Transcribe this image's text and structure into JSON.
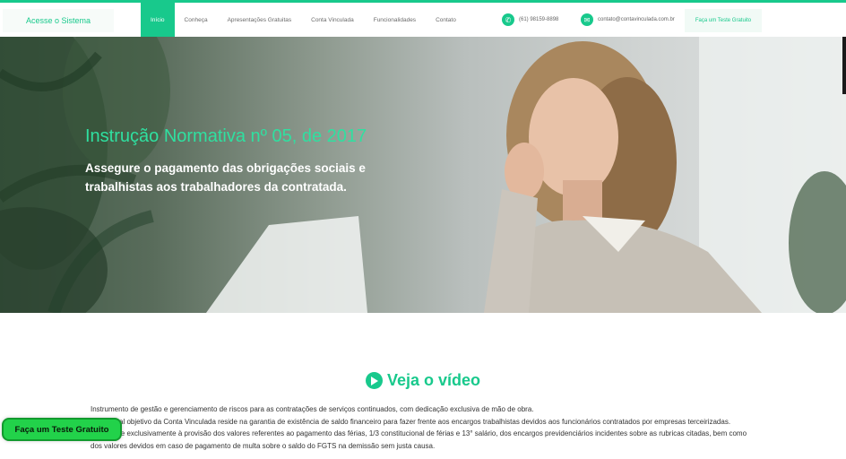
{
  "header": {
    "login": "Acesse o Sistema",
    "nav": [
      "Início",
      "Conheça",
      "Apresentações Gratuitas",
      "Conta Vinculada",
      "Funcionalidades",
      "Contato"
    ],
    "phone": "(61) 98159-8898",
    "email": "contato@contavinculada.com.br",
    "trial": "Faça um Teste Gratuito"
  },
  "hero": {
    "title": "Instrução Normativa nº 05, de 2017",
    "subtitle": "Assegure o pagamento das obrigações sociais e trabalhistas aos trabalhadores da contratada."
  },
  "video": {
    "heading": "Veja o vídeo"
  },
  "content": {
    "p1": "Instrumento de gestão e gerenciamento de riscos para as contratações de serviços continuados, com dedicação exclusiva de mão de obra.",
    "p2": "O principal objetivo da Conta Vinculada reside na garantia de existência de saldo financeiro para fazer frente aos encargos trabalhistas devidos aos funcionários contratados por empresas terceirizadas.",
    "p3": "Destina-se exclusivamente à provisão dos valores referentes ao pagamento das férias, 1/3 constitucional de férias e 13° salário, dos encargos previdenciários incidentes sobre as rubricas citadas, bem como dos valores devidos em caso de pagamento de multa sobre o saldo do FGTS na demissão sem justa causa."
  },
  "float_button": "Faça um Teste Gratuito",
  "colors": {
    "accent": "#18c98c",
    "hero_title": "#2fe0a0",
    "float_btn": "#22d24a"
  }
}
